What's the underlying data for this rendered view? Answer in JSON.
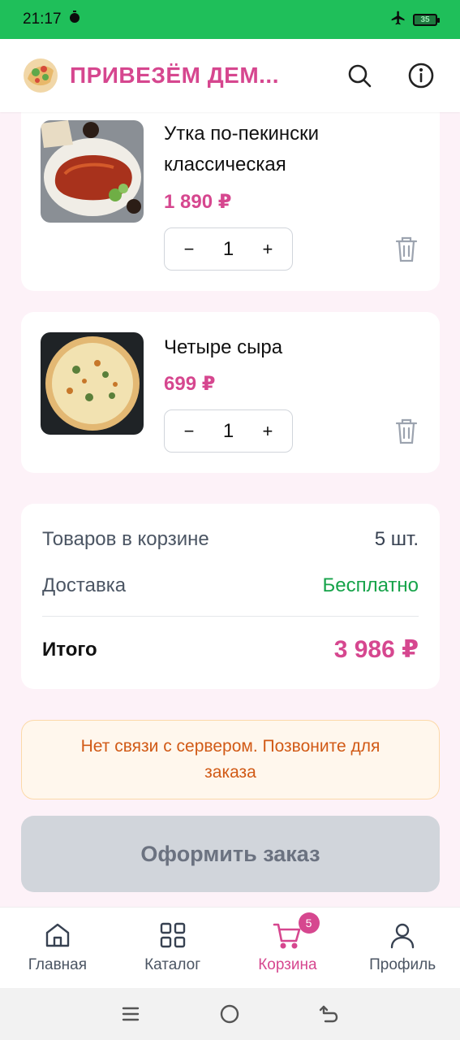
{
  "status_bar": {
    "time": "21:17",
    "battery_level": "35",
    "icons": [
      "timer-icon",
      "airplane-mode-icon",
      "battery-icon"
    ]
  },
  "header": {
    "title": "ПРИВЕЗЁМ ДЕМ...",
    "icons": [
      "search-icon",
      "info-icon"
    ]
  },
  "cart": {
    "items": [
      {
        "name": "Утка по-пекински классическая",
        "price": "1 890 ₽",
        "quantity": "1",
        "minus": "−",
        "plus": "+"
      },
      {
        "name": "Четыре сыра",
        "price": "699 ₽",
        "quantity": "1",
        "minus": "−",
        "plus": "+"
      }
    ]
  },
  "summary": {
    "items_label": "Товаров в корзине",
    "items_value": "5 шт.",
    "delivery_label": "Доставка",
    "delivery_value": "Бесплатно",
    "total_label": "Итого",
    "total_value": "3 986 ₽"
  },
  "alert": {
    "text": "Нет связи с сервером. Позвоните для заказа"
  },
  "checkout": {
    "label": "Оформить заказ"
  },
  "bottom_nav": {
    "items": [
      {
        "label": "Главная",
        "icon": "home-icon"
      },
      {
        "label": "Каталог",
        "icon": "grid-icon"
      },
      {
        "label": "Корзина",
        "icon": "cart-icon",
        "badge": "5",
        "active": true
      },
      {
        "label": "Профиль",
        "icon": "user-icon"
      }
    ]
  },
  "colors": {
    "accent": "#d6478f",
    "status_green": "#1fbf5a",
    "free_green": "#16a34a",
    "warning_text": "#d15a16",
    "warning_bg": "#fff7ed"
  }
}
